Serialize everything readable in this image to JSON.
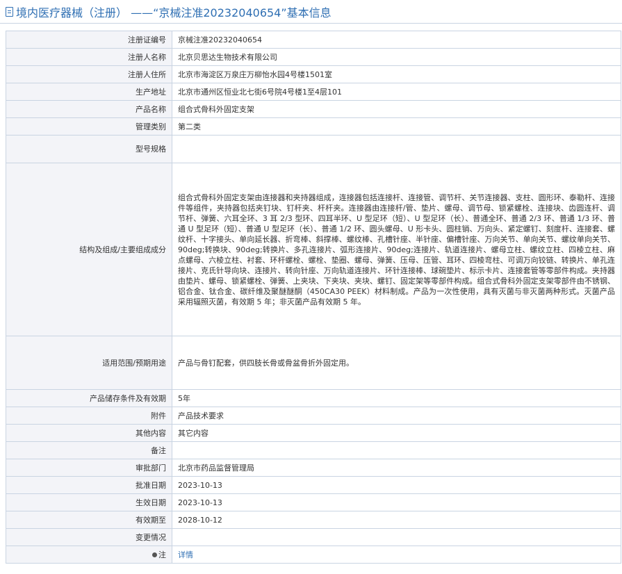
{
  "page": {
    "title": "境内医疗器械（注册） ——“京械注准20232040654”基本信息"
  },
  "rows": [
    {
      "label": "注册证编号",
      "value": "京械注准20232040654"
    },
    {
      "label": "注册人名称",
      "value": "北京贝思达生物技术有限公司"
    },
    {
      "label": "注册人住所",
      "value": "北京市海淀区万泉庄万柳怡水园4号楼1501室"
    },
    {
      "label": "生产地址",
      "value": "北京市通州区恒业北七街6号院4号楼1至4层101"
    },
    {
      "label": "产品名称",
      "value": "组合式骨科外固定支架"
    },
    {
      "label": "管理类别",
      "value": "第二类"
    },
    {
      "label": "型号规格",
      "value": ""
    },
    {
      "label": "结构及组成/主要组成成分",
      "value": "组合式骨科外固定支架由连接器和夹持器组成，连接器包括连接杆、连接管、调节杆、关节连接器、支柱、圆形环、泰勒杆、连接件等组件，夹持器包括夹钉块、钉杆夹、杆杆夹。连接器由连接杆/管、垫片、螺母、调节母、锁紧螺栓、连接块、齿圆连杆、调节杆、弹簧、六耳全环、3 耳 2/3 型环、四耳半环、U 型足环（短）、U 型足环（长）、普通全环、普通 2/3 环、普通 1/3 环、普通 U 型足环（短）、普通 U 型足环（长）、普通 1/2 环、圆头螺母、U 形卡头、圆柱销、万向头、紧定螺钉、刻度杆、连接套、螺纹杆、十字接头、单向延长器、折弯棒、斜撑棒、螺纹棒、孔槽针座、半针座、偏槽针座、万向关节、单向关节、螺纹单向关节、90deg;转换块、90deg;转换片、多孔连接片、弧形连接片、90deg;连接片、轨道连接片、螺母立柱、螺纹立柱、四棱立柱、麻点螺母、六棱立柱、衬套、环杆螺栓、螺栓、垫圈、螺母、弹簧、压母、压管、耳环、四棱弯柱、可调万向铰链、转换片、单孔连接片、克氏针导向块、连接片、转向针座、万向轨道连接片、环针连接棒、球碗垫片、标示卡片、连接套管等零部件构成。夹持器由垫片、螺母、锁紧螺栓、弹簧、上夹块、下夹块、夹块、螺钉、固定架等零部件构成。组合式骨科外固定支架零部件由不锈钢、铝合金、钛合金、碳纤维及聚醚醚酮（450CA30 PEEK）材料制成。产品为一次性使用，具有灭菌与非灭菌两种形式。灭菌产品采用辐照灭菌，有效期 5 年；非灭菌产品有效期 5 年。"
    },
    {
      "label": "适用范围/预期用途",
      "value": "产品与骨钉配套，供四肢长骨或骨盆骨折外固定用。"
    },
    {
      "label": "产品储存条件及有效期",
      "value": "5年"
    },
    {
      "label": "附件",
      "value": "产品技术要求"
    },
    {
      "label": "其他内容",
      "value": "其它内容"
    },
    {
      "label": "备注",
      "value": ""
    },
    {
      "label": "审批部门",
      "value": "北京市药品监督管理局"
    },
    {
      "label": "批准日期",
      "value": "2023-10-13"
    },
    {
      "label": "生效日期",
      "value": "2023-10-13"
    },
    {
      "label": "有效期至",
      "value": "2028-10-12"
    },
    {
      "label": "变更情况",
      "value": ""
    },
    {
      "label": "注",
      "value": "详情"
    }
  ]
}
